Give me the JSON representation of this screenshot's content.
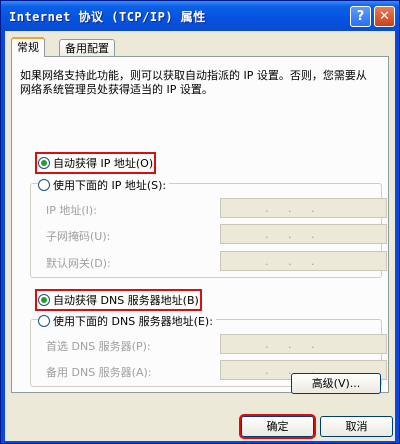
{
  "window": {
    "title": "Internet 协议 (TCP/IP) 属性",
    "help_label": "?",
    "close_label": "✕"
  },
  "tabs": [
    {
      "label": "常规",
      "active": true
    },
    {
      "label": "备用配置",
      "active": false
    }
  ],
  "description": "如果网络支持此功能，则可以获取自动指派的 IP 设置。否则，您需要从网络系统管理员处获得适当的 IP 设置。",
  "ip": {
    "auto_option": "自动获得 IP 地址(O)",
    "manual_option": "使用下面的 IP 地址(S):",
    "selected": "auto",
    "fields": [
      {
        "label": "IP 地址(I):",
        "value": ".   .   ."
      },
      {
        "label": "子网掩码(U):",
        "value": ".   .   ."
      },
      {
        "label": "默认网关(D):",
        "value": ".   .   ."
      }
    ]
  },
  "dns": {
    "auto_option": "自动获得 DNS 服务器地址(B)",
    "manual_option": "使用下面的 DNS 服务器地址(E):",
    "selected": "auto",
    "fields": [
      {
        "label": "首选 DNS 服务器(P):",
        "value": ".   .   ."
      },
      {
        "label": "备用 DNS 服务器(A):",
        "value": ".   .   ."
      }
    ]
  },
  "buttons": {
    "advanced": "高级(V)...",
    "ok": "确定",
    "cancel": "取消"
  },
  "colors": {
    "title_bar": "#0553e0",
    "highlight": "#d61010",
    "dialog_bg": "#ece9d8"
  }
}
